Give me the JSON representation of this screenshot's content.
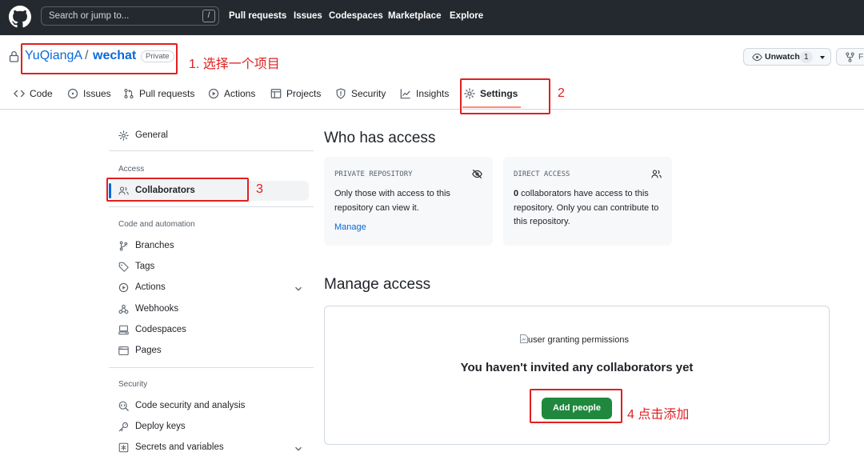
{
  "header": {
    "search_placeholder": "Search or jump to...",
    "slash_key": "/",
    "nav": [
      "Pull requests",
      "Issues",
      "Codespaces",
      "Marketplace",
      "Explore"
    ]
  },
  "repo": {
    "owner": "YuQiangA",
    "separator": "/",
    "name": "wechat",
    "visibility": "Private",
    "watch_label": "Unwatch",
    "watch_count": "1",
    "fork_label": "F"
  },
  "tabs": [
    {
      "label": "Code",
      "icon": "code-icon"
    },
    {
      "label": "Issues",
      "icon": "issue-icon"
    },
    {
      "label": "Pull requests",
      "icon": "pull-request-icon"
    },
    {
      "label": "Actions",
      "icon": "play-icon"
    },
    {
      "label": "Projects",
      "icon": "table-icon"
    },
    {
      "label": "Security",
      "icon": "shield-icon"
    },
    {
      "label": "Insights",
      "icon": "graph-icon"
    },
    {
      "label": "Settings",
      "icon": "gear-icon",
      "active": true
    }
  ],
  "sidebar": {
    "general": "General",
    "access_heading": "Access",
    "collaborators": "Collaborators",
    "code_heading": "Code and automation",
    "code_items": [
      "Branches",
      "Tags",
      "Actions",
      "Webhooks",
      "Codespaces",
      "Pages"
    ],
    "security_heading": "Security",
    "security_items": [
      "Code security and analysis",
      "Deploy keys",
      "Secrets and variables"
    ]
  },
  "main": {
    "who_title": "Who has access",
    "private_card": {
      "kicker": "PRIVATE REPOSITORY",
      "text": "Only those with access to this repository can view it.",
      "link": "Manage"
    },
    "direct_card": {
      "kicker": "DIRECT ACCESS",
      "count": "0",
      "text": " collaborators have access to this repository. Only you can contribute to this repository."
    },
    "manage_title": "Manage access",
    "image_alt": "user granting permissions",
    "empty_title": "You haven't invited any collaborators yet",
    "add_button": "Add people"
  },
  "annotations": {
    "step1": "1. 选择一个项目",
    "step2": "2",
    "step3": "3",
    "step4": "4 点击添加"
  },
  "colors": {
    "header_bg": "#24292f",
    "link": "#0969da",
    "accent_underline": "#fd8c73",
    "primary_button": "#1f883d",
    "annotation_red": "#e02020"
  }
}
